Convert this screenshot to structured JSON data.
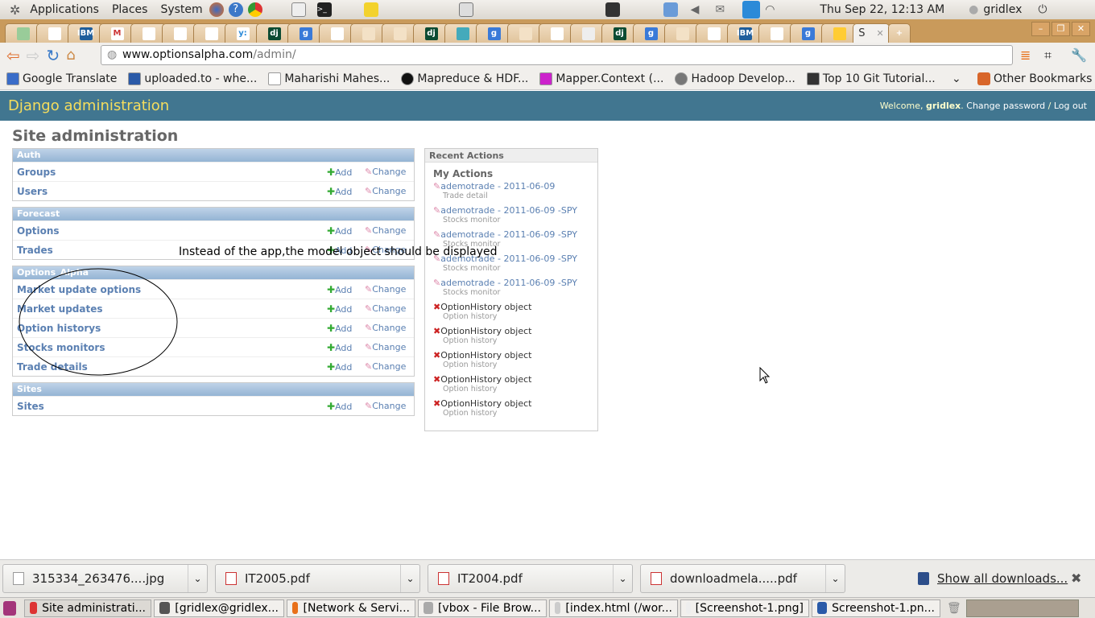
{
  "panel": {
    "menus": [
      "Applications",
      "Places",
      "System"
    ],
    "clock": "Thu Sep 22, 12:13 AM",
    "user": "gridlex",
    "launchers": [
      "firefox-icon",
      "help-icon",
      "chrome-icon",
      "text-editor-icon",
      "terminal-icon",
      "notes-icon",
      "screenshot-icon"
    ],
    "tray": [
      "lock-screen-icon",
      "dropbox-icon",
      "volume-icon",
      "mail-icon",
      "yammer-icon",
      "wifi-icon"
    ]
  },
  "browser": {
    "tabs": [
      {
        "icon": "green-seal-icon"
      },
      {
        "icon": "page-icon"
      },
      {
        "icon": "ibm-icon",
        "text": "IBM"
      },
      {
        "icon": "gmail-icon",
        "text": "M"
      },
      {
        "icon": "page-icon"
      },
      {
        "icon": "page-icon"
      },
      {
        "icon": "page-icon"
      },
      {
        "icon": "yammer-icon",
        "text": "y:"
      },
      {
        "icon": "django-icon",
        "text": "dj"
      },
      {
        "icon": "google-icon",
        "text": "g"
      },
      {
        "icon": "page-icon"
      },
      {
        "icon": "stackoverflow-icon"
      },
      {
        "icon": "stackoverflow-icon"
      },
      {
        "icon": "django-icon",
        "text": "dj"
      },
      {
        "icon": "twitter-icon"
      },
      {
        "icon": "google-icon",
        "text": "g"
      },
      {
        "icon": "stackoverflow-icon"
      },
      {
        "icon": "page-icon"
      },
      {
        "icon": "avatar-icon"
      },
      {
        "icon": "django-icon",
        "text": "dj"
      },
      {
        "icon": "google-icon",
        "text": "g"
      },
      {
        "icon": "stackoverflow-icon"
      },
      {
        "icon": "page-icon"
      },
      {
        "icon": "ibm-icon",
        "text": "IBM"
      },
      {
        "icon": "page-icon"
      },
      {
        "icon": "google-icon",
        "text": "g"
      },
      {
        "icon": "linux-icon"
      }
    ],
    "active_tab": "S",
    "url_host": "www.optionsalpha.com",
    "url_path": "/admin/",
    "bookmarks": [
      "Google Translate",
      "uploaded.to - whe...",
      "Maharishi Mahes...",
      "Mapreduce & HDF...",
      "Mapper.Context (...",
      "Hadoop Develop...",
      "Top 10 Git Tutorial..."
    ],
    "other_bookmarks": "Other Bookmarks"
  },
  "admin": {
    "brand": "Django administration",
    "welcome": "Welcome, ",
    "username": "gridlex",
    "change_password": "Change password",
    "sep": " / ",
    "logout": "Log out",
    "title": "Site administration",
    "add_label": "Add",
    "change_label": "Change",
    "modules": [
      {
        "caption": "Auth",
        "models": [
          "Groups",
          "Users"
        ]
      },
      {
        "caption": "Forecast",
        "models": [
          "Options",
          "Trades"
        ]
      },
      {
        "caption": "Options_Alpha",
        "models": [
          "Market update options",
          "Market updates",
          "Option historys",
          "Stocks monitors",
          "Trade details"
        ]
      },
      {
        "caption": "Sites",
        "models": [
          "Sites"
        ]
      }
    ],
    "recent": {
      "caption": "Recent Actions",
      "heading": "My Actions",
      "items": [
        {
          "type": "change",
          "title": "ademotrade - 2011-06-09",
          "sub": "Trade detail"
        },
        {
          "type": "change",
          "title": "ademotrade - 2011-06-09 -SPY",
          "sub": "Stocks monitor"
        },
        {
          "type": "change",
          "title": "ademotrade - 2011-06-09 -SPY",
          "sub": "Stocks monitor"
        },
        {
          "type": "change",
          "title": "ademotrade - 2011-06-09 -SPY",
          "sub": "Stocks monitor"
        },
        {
          "type": "change",
          "title": "ademotrade - 2011-06-09 -SPY",
          "sub": "Stocks monitor"
        },
        {
          "type": "delete",
          "title": "OptionHistory object",
          "sub": "Option history"
        },
        {
          "type": "delete",
          "title": "OptionHistory object",
          "sub": "Option history"
        },
        {
          "type": "delete",
          "title": "OptionHistory object",
          "sub": "Option history"
        },
        {
          "type": "delete",
          "title": "OptionHistory object",
          "sub": "Option history"
        },
        {
          "type": "delete",
          "title": "OptionHistory object",
          "sub": "Option history"
        }
      ]
    }
  },
  "annotation": "Instead of the app,the model object should be displayed",
  "downloads": {
    "items": [
      "315334_263476....jpg",
      "IT2005.pdf",
      "IT2004.pdf",
      "downloadmela.....pdf"
    ],
    "show_all": "Show all downloads..."
  },
  "taskbar": [
    "Site administrati...",
    "[gridlex@gridlex...",
    "[Network & Servi...",
    "[vbox - File Brow...",
    "[index.html (/wor...",
    "[Screenshot-1.png]",
    "Screenshot-1.pn..."
  ],
  "colors": {
    "header": "#417690",
    "brand": "#f5dd5d",
    "link": "#5b80b2",
    "caption": "#94b4d4"
  }
}
